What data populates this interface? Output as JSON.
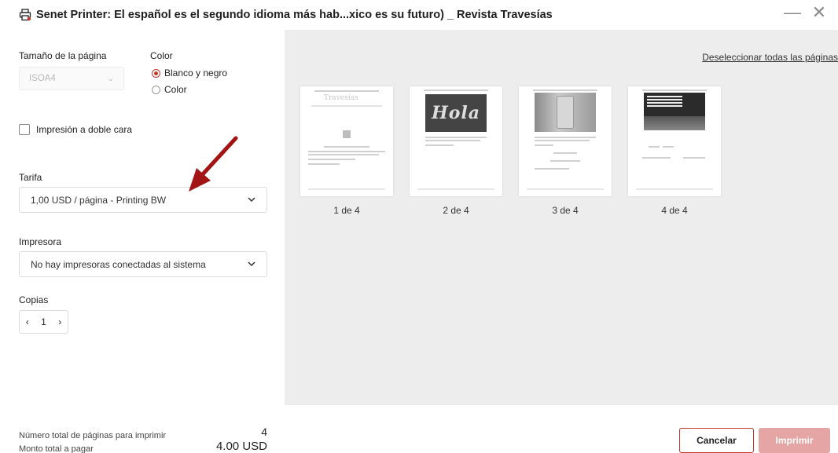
{
  "window": {
    "title": "Senet Printer: El español es el segundo idioma más hab...xico es su futuro) _ Revista Travesías",
    "minimize": "—",
    "close": "✕"
  },
  "settings": {
    "page_size_label": "Tamaño de la página",
    "page_size_value": "ISOA4",
    "color_label": "Color",
    "color_options": [
      "Blanco y negro",
      "Color"
    ],
    "color_selected": "Blanco y negro",
    "duplex_label": "Impresión a doble cara",
    "tariff_label": "Tarifa",
    "tariff_value": "1,00 USD / página - Printing BW",
    "printer_label": "Impresora",
    "printer_value": "No hay impresoras conectadas al sistema",
    "copies_label": "Copias",
    "copies_value": "1"
  },
  "preview": {
    "deselect_all": "Deseleccionar todas las páginas",
    "thumb1_text": "Travesías",
    "hola_text": "Hola",
    "pages": [
      "1 de 4",
      "2 de 4",
      "3 de 4",
      "4 de 4"
    ]
  },
  "footer": {
    "total_pages_label": "Número total de páginas para imprimir",
    "total_pages_value": "4",
    "total_amount_label": "Monto total a pagar",
    "total_amount_value": "4.00 USD",
    "cancel_label": "Cancelar",
    "print_label": "Imprimir"
  },
  "colors": {
    "accent": "#c0392b",
    "print_disabled": "#e6a5a5",
    "preview_bg": "#ededed",
    "annotation_arrow": "#a31515"
  },
  "icons": {
    "app": "printer-icon",
    "select": "chevron-down-icon",
    "stepper_dec": "chevron-left-icon",
    "stepper_inc": "chevron-right-icon"
  }
}
